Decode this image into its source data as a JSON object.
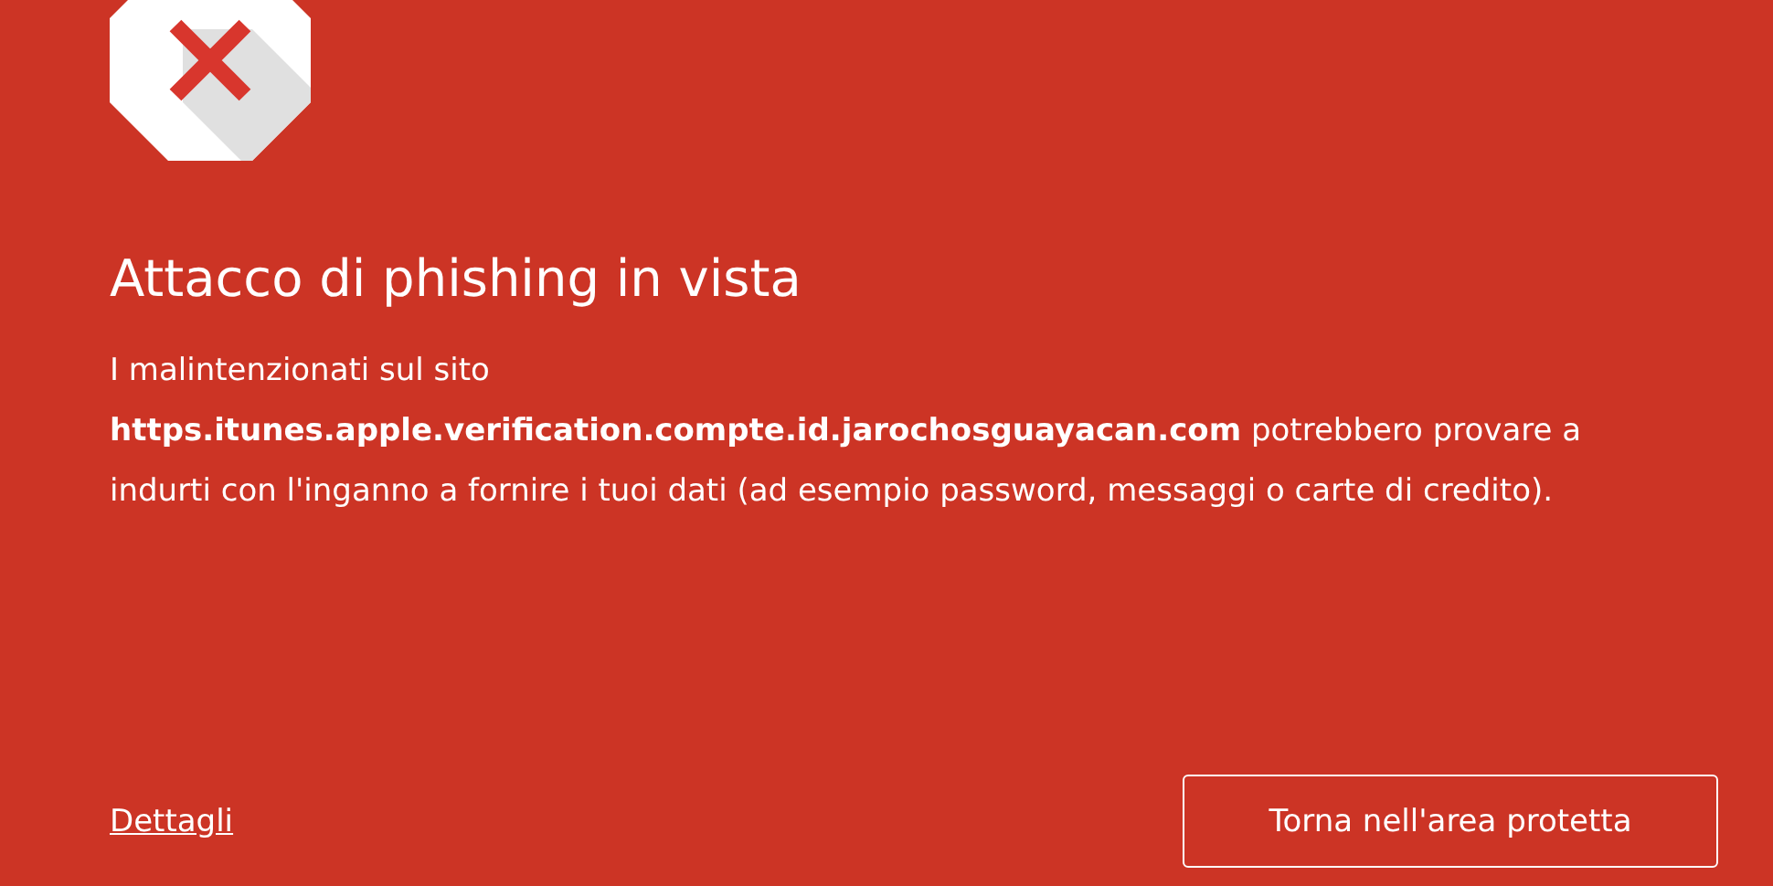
{
  "title": "Attacco di phishing in vista",
  "message": "I malintenzionati sul sito **https.itunes.apple.verification.compte.id.jarochosguayacan.com** potrebbero provare a indurti con l'inganno a fornire i tuoi dati (ad esempio password, messaggi o carte di credito).",
  "details_link": "Dettagli",
  "back_button": "Torna nell'area protetta"
}
